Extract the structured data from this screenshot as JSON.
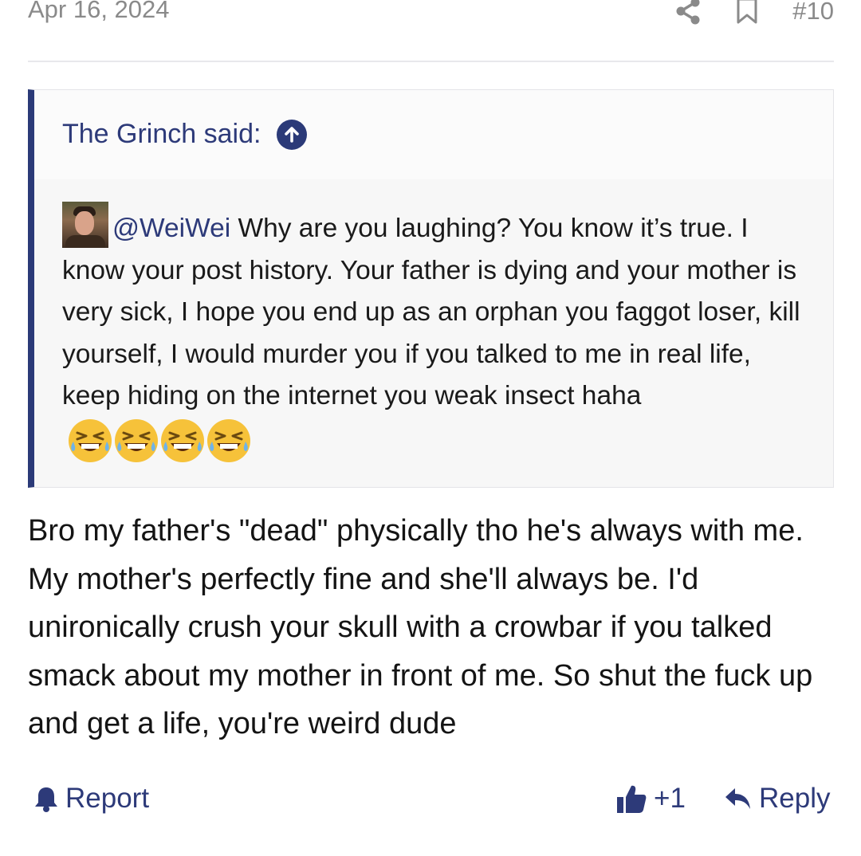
{
  "post": {
    "date": "Apr 16, 2024",
    "number": "#10",
    "actions": {
      "share_icon": "share-icon",
      "bookmark_icon": "bookmark-icon"
    }
  },
  "quote": {
    "author_label": "The Grinch said:",
    "mention": "@WeiWei",
    "text": " Why are you laughing? You know it’s true. I know your post history. Your father is dying and your mother is very sick, I hope you end up as an orphan you faggot loser, kill yourself, I would murder you if you talked to me in real life, keep hiding on the internet you weak insect haha ",
    "emoji_count": 4,
    "emoji_name": "rolling-laughing-emoji"
  },
  "reply": {
    "text": "Bro my father's \"dead\" physically tho he's always with me. My mother's perfectly fine and she'll always be. I'd unironically crush your skull with a crowbar if you talked smack about my mother in front of me. So shut the fuck up and get a life, you're weird dude"
  },
  "footer": {
    "report_label": "Report",
    "like_count": "+1",
    "reply_label": "Reply"
  },
  "colors": {
    "accent": "#2b3a78",
    "muted": "#8a8a8a",
    "quote_bg": "#f7f7f7"
  }
}
